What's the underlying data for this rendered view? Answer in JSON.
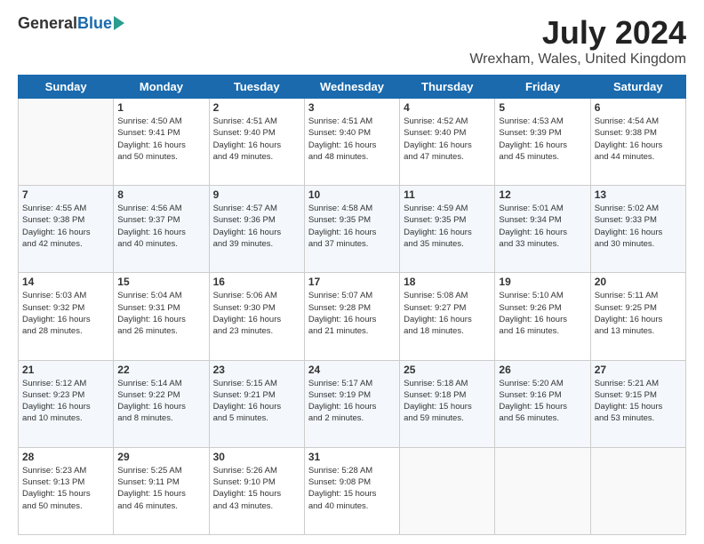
{
  "logo": {
    "general": "General",
    "blue": "Blue"
  },
  "title": "July 2024",
  "subtitle": "Wrexham, Wales, United Kingdom",
  "days": [
    "Sunday",
    "Monday",
    "Tuesday",
    "Wednesday",
    "Thursday",
    "Friday",
    "Saturday"
  ],
  "weeks": [
    [
      {
        "day": "",
        "info": ""
      },
      {
        "day": "1",
        "info": "Sunrise: 4:50 AM\nSunset: 9:41 PM\nDaylight: 16 hours\nand 50 minutes."
      },
      {
        "day": "2",
        "info": "Sunrise: 4:51 AM\nSunset: 9:40 PM\nDaylight: 16 hours\nand 49 minutes."
      },
      {
        "day": "3",
        "info": "Sunrise: 4:51 AM\nSunset: 9:40 PM\nDaylight: 16 hours\nand 48 minutes."
      },
      {
        "day": "4",
        "info": "Sunrise: 4:52 AM\nSunset: 9:40 PM\nDaylight: 16 hours\nand 47 minutes."
      },
      {
        "day": "5",
        "info": "Sunrise: 4:53 AM\nSunset: 9:39 PM\nDaylight: 16 hours\nand 45 minutes."
      },
      {
        "day": "6",
        "info": "Sunrise: 4:54 AM\nSunset: 9:38 PM\nDaylight: 16 hours\nand 44 minutes."
      }
    ],
    [
      {
        "day": "7",
        "info": "Sunrise: 4:55 AM\nSunset: 9:38 PM\nDaylight: 16 hours\nand 42 minutes."
      },
      {
        "day": "8",
        "info": "Sunrise: 4:56 AM\nSunset: 9:37 PM\nDaylight: 16 hours\nand 40 minutes."
      },
      {
        "day": "9",
        "info": "Sunrise: 4:57 AM\nSunset: 9:36 PM\nDaylight: 16 hours\nand 39 minutes."
      },
      {
        "day": "10",
        "info": "Sunrise: 4:58 AM\nSunset: 9:35 PM\nDaylight: 16 hours\nand 37 minutes."
      },
      {
        "day": "11",
        "info": "Sunrise: 4:59 AM\nSunset: 9:35 PM\nDaylight: 16 hours\nand 35 minutes."
      },
      {
        "day": "12",
        "info": "Sunrise: 5:01 AM\nSunset: 9:34 PM\nDaylight: 16 hours\nand 33 minutes."
      },
      {
        "day": "13",
        "info": "Sunrise: 5:02 AM\nSunset: 9:33 PM\nDaylight: 16 hours\nand 30 minutes."
      }
    ],
    [
      {
        "day": "14",
        "info": "Sunrise: 5:03 AM\nSunset: 9:32 PM\nDaylight: 16 hours\nand 28 minutes."
      },
      {
        "day": "15",
        "info": "Sunrise: 5:04 AM\nSunset: 9:31 PM\nDaylight: 16 hours\nand 26 minutes."
      },
      {
        "day": "16",
        "info": "Sunrise: 5:06 AM\nSunset: 9:30 PM\nDaylight: 16 hours\nand 23 minutes."
      },
      {
        "day": "17",
        "info": "Sunrise: 5:07 AM\nSunset: 9:28 PM\nDaylight: 16 hours\nand 21 minutes."
      },
      {
        "day": "18",
        "info": "Sunrise: 5:08 AM\nSunset: 9:27 PM\nDaylight: 16 hours\nand 18 minutes."
      },
      {
        "day": "19",
        "info": "Sunrise: 5:10 AM\nSunset: 9:26 PM\nDaylight: 16 hours\nand 16 minutes."
      },
      {
        "day": "20",
        "info": "Sunrise: 5:11 AM\nSunset: 9:25 PM\nDaylight: 16 hours\nand 13 minutes."
      }
    ],
    [
      {
        "day": "21",
        "info": "Sunrise: 5:12 AM\nSunset: 9:23 PM\nDaylight: 16 hours\nand 10 minutes."
      },
      {
        "day": "22",
        "info": "Sunrise: 5:14 AM\nSunset: 9:22 PM\nDaylight: 16 hours\nand 8 minutes."
      },
      {
        "day": "23",
        "info": "Sunrise: 5:15 AM\nSunset: 9:21 PM\nDaylight: 16 hours\nand 5 minutes."
      },
      {
        "day": "24",
        "info": "Sunrise: 5:17 AM\nSunset: 9:19 PM\nDaylight: 16 hours\nand 2 minutes."
      },
      {
        "day": "25",
        "info": "Sunrise: 5:18 AM\nSunset: 9:18 PM\nDaylight: 15 hours\nand 59 minutes."
      },
      {
        "day": "26",
        "info": "Sunrise: 5:20 AM\nSunset: 9:16 PM\nDaylight: 15 hours\nand 56 minutes."
      },
      {
        "day": "27",
        "info": "Sunrise: 5:21 AM\nSunset: 9:15 PM\nDaylight: 15 hours\nand 53 minutes."
      }
    ],
    [
      {
        "day": "28",
        "info": "Sunrise: 5:23 AM\nSunset: 9:13 PM\nDaylight: 15 hours\nand 50 minutes."
      },
      {
        "day": "29",
        "info": "Sunrise: 5:25 AM\nSunset: 9:11 PM\nDaylight: 15 hours\nand 46 minutes."
      },
      {
        "day": "30",
        "info": "Sunrise: 5:26 AM\nSunset: 9:10 PM\nDaylight: 15 hours\nand 43 minutes."
      },
      {
        "day": "31",
        "info": "Sunrise: 5:28 AM\nSunset: 9:08 PM\nDaylight: 15 hours\nand 40 minutes."
      },
      {
        "day": "",
        "info": ""
      },
      {
        "day": "",
        "info": ""
      },
      {
        "day": "",
        "info": ""
      }
    ]
  ]
}
